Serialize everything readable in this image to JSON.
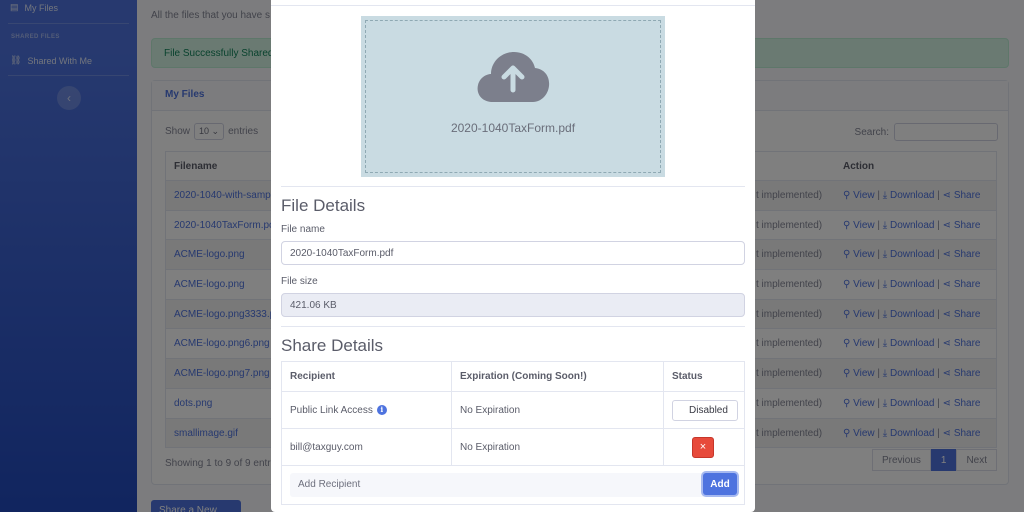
{
  "sidebar": {
    "my_files": "My Files",
    "section_heading": "SHARED FILES",
    "shared_with_me": "Shared With Me",
    "toggle_icon": "chevron-left-icon"
  },
  "content": {
    "intro": "All the files that you have s",
    "alert": "File Successfully Shared!",
    "card_title": "My Files",
    "show_label": "Show",
    "entries_value": "10",
    "entries_label": "entries",
    "search_label": "Search:",
    "columns": {
      "filename": "Filename",
      "action": "Action"
    },
    "rows": [
      {
        "filename": "2020-1040-with-samp",
        "status": "t implemented)"
      },
      {
        "filename": "2020-1040TaxForm.pc",
        "status": "t implemented)"
      },
      {
        "filename": "ACME-logo.png",
        "status": "t implemented)"
      },
      {
        "filename": "ACME-logo.png",
        "status": "t implemented)"
      },
      {
        "filename": "ACME-logo.png3333.p",
        "status": "t implemented)"
      },
      {
        "filename": "ACME-logo.png6.png",
        "status": "t implemented)"
      },
      {
        "filename": "ACME-logo.png7.png",
        "status": "t implemented)"
      },
      {
        "filename": "dots.png",
        "status": "t implemented)"
      },
      {
        "filename": "smallimage.gif",
        "status": "t implemented)"
      }
    ],
    "actions": {
      "view": "View",
      "download": "Download",
      "share": "Share",
      "sep": "|"
    },
    "showing": "Showing 1 to 9 of 9 entri",
    "pager": {
      "previous": "Previous",
      "page": "1",
      "next": "Next"
    },
    "share_new": "Share a New File"
  },
  "modal": {
    "dropzone_filename": "2020-1040TaxForm.pdf",
    "file_details_title": "File Details",
    "file_name_label": "File name",
    "file_name_value": "2020-1040TaxForm.pdf",
    "file_size_label": "File size",
    "file_size_value": "421.06 KB",
    "share_details_title": "Share Details",
    "share_columns": {
      "recipient": "Recipient",
      "expiration": "Expiration (Coming Soon!)",
      "status": "Status"
    },
    "share_rows": [
      {
        "recipient": "Public Link Access",
        "expiration": "No Expiration",
        "status_button": "Disabled"
      },
      {
        "recipient": "bill@taxguy.com",
        "expiration": "No Expiration",
        "remove_button": "×"
      }
    ],
    "add_recipient_placeholder": "Add Recipient",
    "add_button": "Add"
  },
  "colors": {
    "primary": "#4e73df",
    "danger": "#e74a3b",
    "success_bg": "#d4f5e4",
    "dropzone_bg": "#c9dbe2"
  }
}
